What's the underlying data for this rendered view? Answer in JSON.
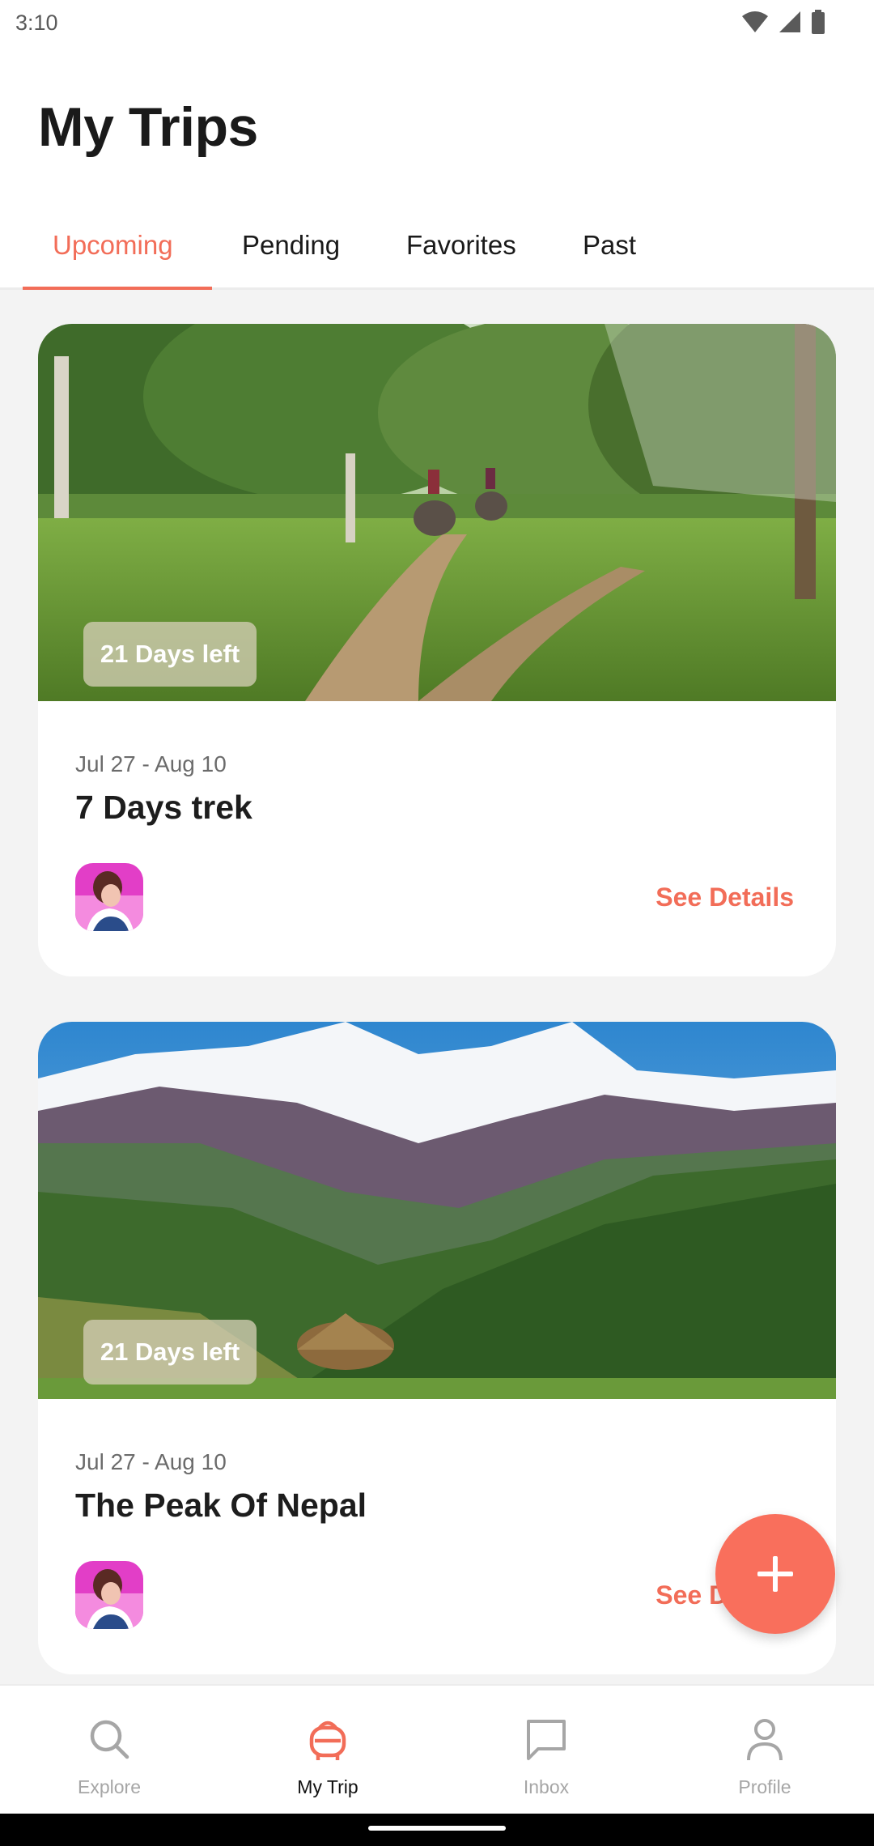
{
  "status_bar": {
    "time": "3:10"
  },
  "header": {
    "title": "My Trips"
  },
  "tabs": [
    {
      "label": "Upcoming",
      "active": true
    },
    {
      "label": "Pending",
      "active": false
    },
    {
      "label": "Favorites",
      "active": false
    },
    {
      "label": "Past",
      "active": false
    }
  ],
  "trips": [
    {
      "badge": "21 Days left",
      "dates": "Jul 27 - Aug 10",
      "title": "7 Days trek",
      "action": "See Details"
    },
    {
      "badge": "21 Days left",
      "dates": "Jul 27 - Aug 10",
      "title": "The Peak Of Nepal",
      "action": "See Details"
    }
  ],
  "fab": {
    "icon": "plus-icon"
  },
  "bottom_nav": [
    {
      "label": "Explore",
      "icon": "search-icon",
      "active": false
    },
    {
      "label": "My Trip",
      "icon": "trip-icon",
      "active": true
    },
    {
      "label": "Inbox",
      "icon": "chat-icon",
      "active": false
    },
    {
      "label": "Profile",
      "icon": "person-icon",
      "active": false
    }
  ],
  "colors": {
    "accent": "#f26d58",
    "fab": "#f96f5c",
    "inactive_nav": "#a6a6a6"
  }
}
